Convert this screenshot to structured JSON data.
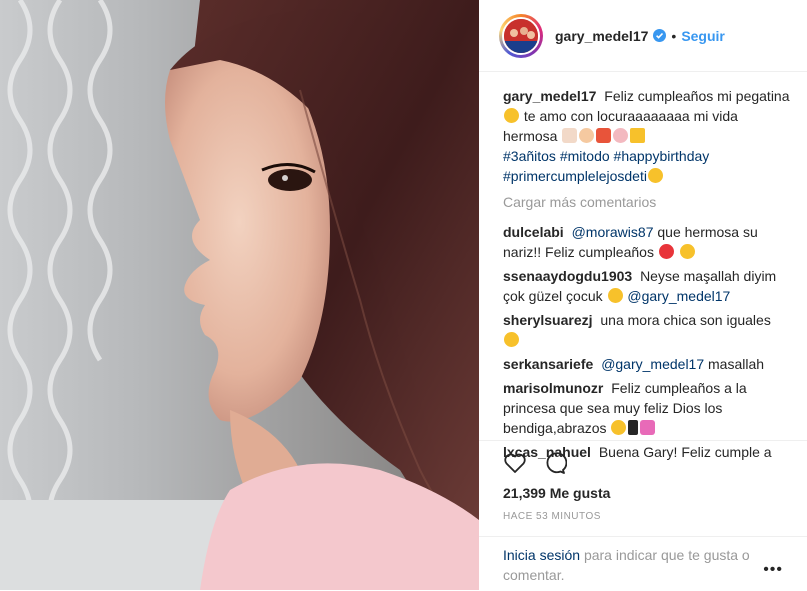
{
  "post": {
    "username": "gary_medel17",
    "follow_label": "Seguir",
    "dot": "•"
  },
  "caption": {
    "user": "gary_medel17",
    "text": "Feliz cumpleaños mi pegatina",
    "text2": "te amo con locuraaaaaaaa mi vida hermosa",
    "hashtags": [
      "#3añitos",
      "#mitodo",
      "#happybirthday",
      "#primercumplelejosdeti"
    ]
  },
  "load_more": "Cargar más comentarios",
  "comments": [
    {
      "user": "dulcelabi",
      "mention": "@morawis87",
      "text": "que hermosa su nariz!! Feliz cumpleaños"
    },
    {
      "user": "ssenaaydogdu1903",
      "text": "Neyse maşallah diyim çok güzel çocuk",
      "mention": "@gary_medel17"
    },
    {
      "user": "sherylsuarezj",
      "text": "una mora chica son iguales"
    },
    {
      "user": "serkansariefe",
      "mention": "@gary_medel17",
      "text": "masallah"
    },
    {
      "user": "marisolmunozr",
      "text": "Feliz cumpleaños a la princesa que sea muy feliz Dios los bendiga,abrazos"
    },
    {
      "user": "lxcas_nahuel",
      "text": "Buena Gary! Feliz cumple a"
    }
  ],
  "likes": "21,399 Me gusta",
  "time": "HACE 53 MINUTOS",
  "login": {
    "link": "Inicia sesión",
    "text": "para indicar que te gusta o comentar."
  },
  "more_dots": "•••",
  "icons": [
    "heart-icon",
    "comment-icon",
    "verified-icon",
    "more-options-icon"
  ],
  "colors": {
    "link": "#3897f0",
    "tag": "#003569",
    "muted": "#999999"
  }
}
